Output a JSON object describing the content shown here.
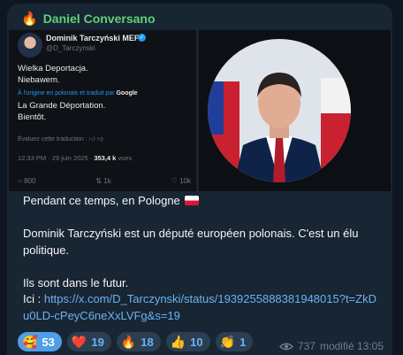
{
  "header": {
    "sender_icon": "🔥",
    "sender_name": "Daniel Conversano"
  },
  "tweet": {
    "name": "Dominik Tarczyński MEP",
    "handle": "@D_Tarczynski",
    "line1": "Wielka Deportacja.",
    "line2": "Niebawem.",
    "translate_note": "À l'origine en polonais et traduit par",
    "translate_brand": "Google",
    "line3": "La Grande Déportation.",
    "line4": "Bientôt.",
    "rate_label": "Évaluez cette traduction :",
    "time": "12:33 PM · 29 juin 2025 ·",
    "views_count": "353,4 k",
    "views_label": "vues",
    "replies": "800",
    "retweets": "1k",
    "likes": "10k"
  },
  "message": {
    "p1": "Pendant ce temps, en Pologne",
    "p2": "Dominik Tarczyński est un député européen polonais. C'est un élu politique.",
    "p3": "Ils sont dans le futur.",
    "link_prefix": "Ici : ",
    "link": "https://x.com/D_Tarczynski/status/1939255888381948015?t=ZkDu0LD-cPeyC6neXxLVFg&s=19"
  },
  "reactions": [
    {
      "emoji": "🥰",
      "count": "53"
    },
    {
      "emoji": "❤️",
      "count": "19"
    },
    {
      "emoji": "🔥",
      "count": "18"
    },
    {
      "emoji": "👍",
      "count": "10"
    },
    {
      "emoji": "👏",
      "count": "1"
    }
  ],
  "footer": {
    "views": "737",
    "status": "modifié 13:05"
  },
  "colors": {
    "sender": "#5fd078",
    "link": "#6ab3f3",
    "bubble": "#182533",
    "active_reaction": "#4f9ee8"
  }
}
